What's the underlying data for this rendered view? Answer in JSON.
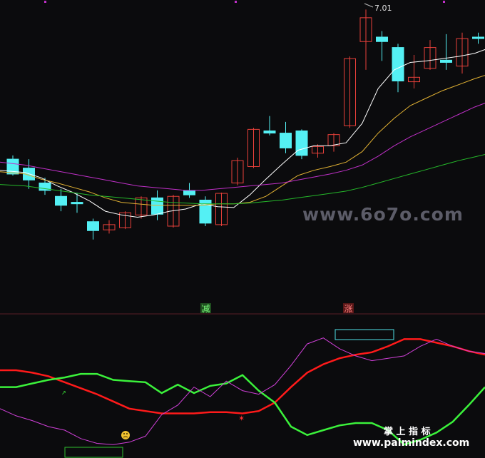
{
  "colors": {
    "background": "#0b0b0d",
    "up": "#e8403a",
    "down": "#54f0f4",
    "ma_white": "#ffffff",
    "ma_gold": "#e2b233",
    "ma_magenta": "#c030c8",
    "ma_green": "#25b82a",
    "osc_red": "#ff1a1a",
    "osc_green": "#3bf23b",
    "osc_magenta": "#d040d8",
    "divider": "#5a1e28",
    "watermark": "#5a5a66",
    "markers": "#c030c8"
  },
  "peak_label": "7.01",
  "signals": {
    "reduce": "减",
    "rise": "涨"
  },
  "watermarks": {
    "top": "www.6o7o.com",
    "brand": "掌 上 指 标",
    "site": "www.palmindex.com"
  },
  "chart_data": [
    {
      "type": "candlestick",
      "title": "",
      "ylim": [
        3.4,
        7.1
      ],
      "max_price": 7.01,
      "x": [
        1,
        2,
        3,
        4,
        5,
        6,
        7,
        8,
        9,
        10,
        11,
        12,
        13,
        14,
        15,
        16,
        17,
        18,
        19,
        20,
        21,
        22,
        23,
        24,
        25,
        26,
        27,
        28,
        29,
        30,
        31
      ],
      "candles": [
        {
          "o": 5.0,
          "h": 5.05,
          "l": 4.78,
          "c": 4.8
        },
        {
          "o": 4.88,
          "h": 5.0,
          "l": 4.6,
          "c": 4.72
        },
        {
          "o": 4.68,
          "h": 4.75,
          "l": 4.52,
          "c": 4.58
        },
        {
          "o": 4.5,
          "h": 4.6,
          "l": 4.3,
          "c": 4.38
        },
        {
          "o": 4.42,
          "h": 4.55,
          "l": 4.28,
          "c": 4.4
        },
        {
          "o": 4.16,
          "h": 4.2,
          "l": 3.92,
          "c": 4.04
        },
        {
          "o": 4.05,
          "h": 4.18,
          "l": 4.0,
          "c": 4.12
        },
        {
          "o": 4.08,
          "h": 4.3,
          "l": 4.06,
          "c": 4.28
        },
        {
          "o": 4.25,
          "h": 4.5,
          "l": 4.2,
          "c": 4.48
        },
        {
          "o": 4.48,
          "h": 4.58,
          "l": 4.18,
          "c": 4.26
        },
        {
          "o": 4.1,
          "h": 4.52,
          "l": 4.08,
          "c": 4.5
        },
        {
          "o": 4.58,
          "h": 4.68,
          "l": 4.48,
          "c": 4.52
        },
        {
          "o": 4.45,
          "h": 4.5,
          "l": 4.1,
          "c": 4.14
        },
        {
          "o": 4.12,
          "h": 4.55,
          "l": 4.1,
          "c": 4.54
        },
        {
          "o": 4.68,
          "h": 5.02,
          "l": 4.65,
          "c": 4.98
        },
        {
          "o": 4.9,
          "h": 5.42,
          "l": 4.88,
          "c": 5.4
        },
        {
          "o": 5.38,
          "h": 5.58,
          "l": 5.32,
          "c": 5.35
        },
        {
          "o": 5.35,
          "h": 5.5,
          "l": 5.08,
          "c": 5.15
        },
        {
          "o": 5.38,
          "h": 5.4,
          "l": 5.0,
          "c": 5.05
        },
        {
          "o": 5.08,
          "h": 5.2,
          "l": 5.02,
          "c": 5.17
        },
        {
          "o": 5.18,
          "h": 5.35,
          "l": 5.1,
          "c": 5.33
        },
        {
          "o": 5.45,
          "h": 6.38,
          "l": 5.42,
          "c": 6.35
        },
        {
          "o": 6.58,
          "h": 7.01,
          "l": 6.2,
          "c": 6.9
        },
        {
          "o": 6.64,
          "h": 6.72,
          "l": 6.32,
          "c": 6.58
        },
        {
          "o": 6.5,
          "h": 6.55,
          "l": 5.9,
          "c": 6.05
        },
        {
          "o": 6.04,
          "h": 6.4,
          "l": 5.95,
          "c": 6.1
        },
        {
          "o": 6.22,
          "h": 6.6,
          "l": 6.2,
          "c": 6.5
        },
        {
          "o": 6.33,
          "h": 6.68,
          "l": 6.2,
          "c": 6.3
        },
        {
          "o": 6.25,
          "h": 6.7,
          "l": 6.15,
          "c": 6.62
        },
        {
          "o": 6.64,
          "h": 6.7,
          "l": 6.55,
          "c": 6.62
        }
      ],
      "series": [
        {
          "values": [
            4.85,
            4.82,
            4.75,
            4.64,
            4.55,
            4.44,
            4.3,
            4.25,
            4.22,
            4.25,
            4.3,
            4.33,
            4.4,
            4.36,
            4.35,
            4.52,
            4.73,
            4.93,
            5.12,
            5.18,
            5.18,
            5.22,
            5.48,
            5.95,
            6.2,
            6.3,
            6.32,
            6.35,
            6.38,
            6.42,
            6.5
          ]
        },
        {
          "values": [
            4.83,
            4.8,
            4.73,
            4.68,
            4.62,
            4.56,
            4.48,
            4.42,
            4.4,
            4.38,
            4.38,
            4.38,
            4.38,
            4.4,
            4.4,
            4.42,
            4.5,
            4.64,
            4.78,
            4.85,
            4.9,
            4.96,
            5.1,
            5.35,
            5.55,
            5.72,
            5.82,
            5.92,
            6.0,
            6.08,
            6.15
          ]
        },
        {
          "values": [
            4.96,
            4.92,
            4.88,
            4.84,
            4.8,
            4.76,
            4.72,
            4.68,
            4.64,
            4.62,
            4.6,
            4.58,
            4.58,
            4.6,
            4.62,
            4.64,
            4.66,
            4.68,
            4.72,
            4.76,
            4.8,
            4.85,
            4.92,
            5.04,
            5.18,
            5.3,
            5.4,
            5.5,
            5.6,
            5.7,
            5.78
          ]
        },
        {
          "values": [
            4.66,
            4.64,
            4.61,
            4.58,
            4.55,
            4.52,
            4.5,
            4.48,
            4.46,
            4.44,
            4.42,
            4.41,
            4.4,
            4.4,
            4.4,
            4.41,
            4.43,
            4.45,
            4.48,
            4.51,
            4.54,
            4.57,
            4.62,
            4.68,
            4.74,
            4.8,
            4.86,
            4.92,
            4.98,
            5.03,
            5.08
          ]
        }
      ]
    },
    {
      "type": "line",
      "title": "",
      "ylim": [
        0,
        100
      ],
      "x": [
        1,
        2,
        3,
        4,
        5,
        6,
        7,
        8,
        9,
        10,
        11,
        12,
        13,
        14,
        15,
        16,
        17,
        18,
        19,
        20,
        21,
        22,
        23,
        24,
        25,
        26,
        27,
        28,
        29,
        30,
        31
      ],
      "series": [
        {
          "values": [
            72,
            72,
            70,
            67,
            62,
            57,
            52,
            46,
            40,
            38,
            36,
            36,
            36,
            37,
            37,
            36,
            38,
            45,
            58,
            70,
            77,
            82,
            85,
            87,
            92,
            98,
            98,
            95,
            92,
            88,
            85
          ]
        },
        {
          "values": [
            58,
            58,
            61,
            64,
            66,
            69,
            69,
            64,
            63,
            62,
            53,
            60,
            53,
            59,
            61,
            68,
            55,
            45,
            25,
            18,
            22,
            26,
            28,
            28,
            22,
            10,
            14,
            20,
            29,
            43,
            58
          ]
        },
        {
          "values": [
            40,
            34,
            30,
            25,
            22,
            15,
            11,
            10,
            12,
            17,
            35,
            43,
            58,
            50,
            63,
            55,
            52,
            60,
            76,
            94,
            99,
            90,
            84,
            80,
            82,
            84,
            92,
            98,
            92,
            88,
            86
          ]
        }
      ]
    }
  ]
}
